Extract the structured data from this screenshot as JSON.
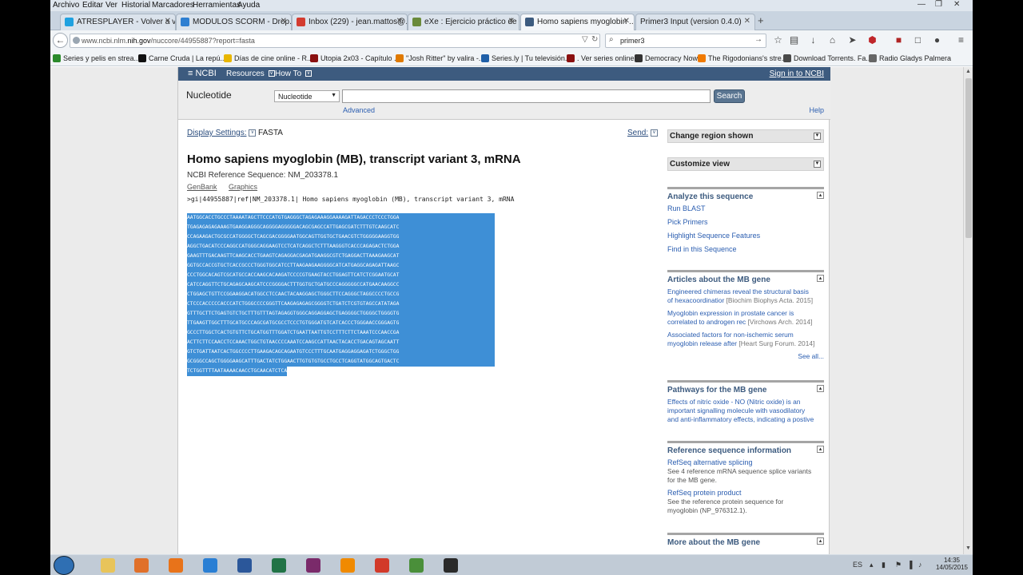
{
  "menubar": [
    "Archivo",
    "Editar",
    "Ver",
    "Historial",
    "Marcadores",
    "Herramientas",
    "Ayuda"
  ],
  "tabs": [
    {
      "label": "ATRESPLAYER - Volver a ve...",
      "color": "#1fa1e0"
    },
    {
      "label": "MODULOS SCORM - Drop...",
      "color": "#2e7fd1"
    },
    {
      "label": "Inbox (229) - jean.mattos@...",
      "color": "#d33c30"
    },
    {
      "label": "eXe : Ejercicio práctico de ...",
      "color": "#6a8a3a"
    },
    {
      "label": "Homo sapiens myoglobin ...",
      "color": "#3d5b7f"
    },
    {
      "label": "Primer3 Input (version 0.4.0)",
      "color": "#b0b0b0"
    }
  ],
  "nav": {
    "url_prefix": "www.ncbi.nlm.",
    "url_host": "nih.gov",
    "url_path": "/nuccore/44955887?report=fasta",
    "search_value": "primer3"
  },
  "bookmarks": [
    {
      "label": "Series y pelis en strea...",
      "color": "#2b8a2b"
    },
    {
      "label": "Carne Cruda | La repú...",
      "color": "#111111"
    },
    {
      "label": "Días de cine online - R...",
      "color": "#e8b600"
    },
    {
      "label": "Utopia 2x03 - Capítulo ...",
      "color": "#8a1010"
    },
    {
      "label": "\"Josh Ritter\" by valira -...",
      "color": "#e07a00"
    },
    {
      "label": "Series.ly | Tu televisión...",
      "color": "#1f5fa8"
    },
    {
      "label": ". Ver series online.",
      "color": "#8a1010"
    },
    {
      "label": "Democracy Now!",
      "color": "#333333"
    },
    {
      "label": "The Rigodonians's stre...",
      "color": "#f07a00"
    },
    {
      "label": "Download Torrents. Fa...",
      "color": "#4a4a4a"
    },
    {
      "label": "Radio Gladys Palmera",
      "color": "#666666"
    }
  ],
  "ncbi": {
    "logo": "NCBI",
    "resources": "Resources",
    "howto": "How To",
    "signin": "Sign in to NCBI",
    "db_name": "Nucleotide",
    "db_select": "Nucleotide",
    "search_button": "Search",
    "advanced": "Advanced",
    "help": "Help"
  },
  "record": {
    "display_settings": "Display Settings:",
    "format": "FASTA",
    "send": "Send:",
    "title": "Homo sapiens myoglobin (MB), transcript variant 3, mRNA",
    "refseq": "NCBI Reference Sequence: NM_203378.1",
    "link_genbank": "GenBank",
    "link_graphics": "Graphics",
    "fasta_header": ">gi|44955887|ref|NM_203378.1| Homo sapiens myoglobin (MB), transcript variant 3, mRNA",
    "sequence_lines": [
      "AATGGCACCTGCCCTAAAATAGCTTCCCATGTGAGGGCTAGAGAAAGGAAAAGATTAGACCCTCCCTGGA",
      "TGAGAGAGAGAAAGTGAAGGAGGGCAGGGGAGGGGGACAGCGAGCCATTGAGCGATCTTTGTCAAGCATC",
      "CCAGAAGACTGCGCCATGGGGCTCAGCGACGGGGAATGGCAGTTGGTGCTGAACGTCTGGGGGAAGGTGG",
      "AGGCTGACATCCCAGGCCATGGGCAGGAAGTCCTCATCAGGCTCTTTAAGGGTCACCCAGAGACTCTGGA",
      "GAAGTTTGACAAGTTCAAGCACCTGAAGTCAGAGGACGAGATGAAGGCGTCTGAGGACTTAAAGAAGCAT",
      "GGTGCCACCGTGCTCACCGCCCTGGGTGGCATCCTTAAGAAGAAGGGGCATCATGAGGCAGAGATTAAGC",
      "CCCTGGCACAGTCGCATGCCACCAAGCACAAGATCCCCGTGAAGTACCTGGAGTTCATCTCGGAATGCAT",
      "CATCCAGGTTCTGCAGAGCAAGCATCCCGGGGACTTTGGTGCTGATGCCCAGGGGGCCATGAACAAGGCC",
      "CTGGAGCTGTTCCGGAAGGACATGGCCTCCAACTACAAGGAGCTGGGCTTCCAGGGCTAGGCCCCTGCCG",
      "CTCCCACCCCCACCCATCTGGGCCCCGGGTTCAAGAGAGAGCGGGGTCTGATCTCGTGTAGCCATATAGA",
      "GTTTGCTTCTGAGTGTCTGCTTTGTTTAGTAGAGGTGGGCAGGAGGAGCTGAGGGGCTGGGGCTGGGGTG",
      "TTGAAGTTGGCTTTGCATGCCCAGCGATGCGCCTCCCTGTGGGATGTCATCACCCTGGGAACCGGGAGTG",
      "GCCCTTGGCTCACTGTGTTCTGCATGGTTTGGATCTGAATTAATTGTCCTTTCTTCTAAATCCCAACCGA",
      "ACTTCTTCCAACCTCCAAACTGGCTGTAACCCCAAATCCAAGCCATTAACTACACCTGACAGTAGCAATT",
      "GTCTGATTAATCACTGGCCCCTTGAAGACAGCAGAATGTCCCTTTGCAATGAGGAGGAGATCTGGGCTGG",
      "GCGGGCCAGCTGGGGAAGCATTTGACTATCTGGAACTTGTGTGTGCCTGCCTCAGGTATGGCAGTGACTC",
      "TCTGGTTTTAATAAAACAACCTGCAACATCTCA"
    ]
  },
  "sidebar": {
    "change_region": "Change region shown",
    "customize_view": "Customize view",
    "analyze": {
      "title": "Analyze this sequence",
      "items": [
        "Run BLAST",
        "Pick Primers",
        "Highlight Sequence Features",
        "Find in this Sequence"
      ]
    },
    "articles": {
      "title": "Articles about the MB gene",
      "items": [
        {
          "l1": "Engineered chimeras reveal the structural basis",
          "l2": "of hexacoordinatior",
          "src": "[Biochim Biophys Acta. 2015]"
        },
        {
          "l1": "Myoglobin expression in prostate cancer is",
          "l2": "correlated to androgen rec",
          "src": "[Virchows Arch. 2014]"
        },
        {
          "l1": "Associated factors for non-ischemic serum",
          "l2": "myoglobin release after",
          "src": "[Heart Surg Forum. 2014]"
        }
      ],
      "see_all": "See all..."
    },
    "pathways": {
      "title": "Pathways for the MB gene",
      "l1": "Effects of nitric oxide - NO (Nitric oxide) is an",
      "l2": "important signalling molecule with vasodilatory",
      "l3": "and anti-inflammatory effects, indicating a postive"
    },
    "refinfo": {
      "title": "Reference sequence information",
      "item1": "RefSeq alternative splicing",
      "item1_d1": "See 4 reference mRNA sequence splice variants",
      "item1_d2": "for the MB gene.",
      "item2": "RefSeq protein product",
      "item2_d1": "See the reference protein sequence for",
      "item2_d2": "myoglobin (NP_976312.1)."
    },
    "more": {
      "title": "More about the MB gene"
    }
  },
  "taskbar": {
    "apps": [
      {
        "name": "explorer",
        "color": "#e8c45a"
      },
      {
        "name": "media-player",
        "color": "#e0702a"
      },
      {
        "name": "firefox",
        "color": "#e8731a"
      },
      {
        "name": "internet-explorer",
        "color": "#2a7fd4"
      },
      {
        "name": "word",
        "color": "#2b579a"
      },
      {
        "name": "excel",
        "color": "#217346"
      },
      {
        "name": "scorm-tool",
        "color": "#7a2a6a"
      },
      {
        "name": "vlc",
        "color": "#f08a00"
      },
      {
        "name": "mushroom-game",
        "color": "#d23a2a"
      },
      {
        "name": "chrome",
        "color": "#4a8f3a"
      },
      {
        "name": "editor",
        "color": "#2a2a2a"
      }
    ],
    "lang": "ES",
    "time": "14:35",
    "date": "14/05/2015"
  }
}
